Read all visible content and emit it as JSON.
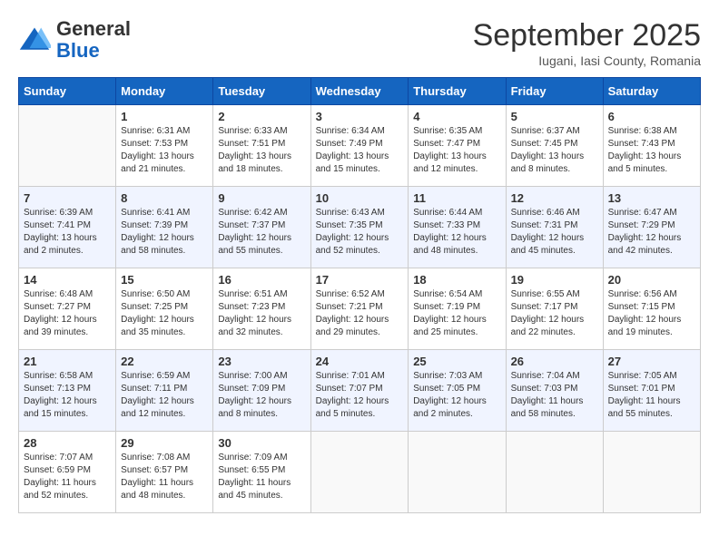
{
  "logo": {
    "general": "General",
    "blue": "Blue"
  },
  "title": {
    "month": "September 2025",
    "location": "Iugani, Iasi County, Romania"
  },
  "days_header": [
    "Sunday",
    "Monday",
    "Tuesday",
    "Wednesday",
    "Thursday",
    "Friday",
    "Saturday"
  ],
  "weeks": [
    [
      {
        "day": "",
        "info": ""
      },
      {
        "day": "1",
        "info": "Sunrise: 6:31 AM\nSunset: 7:53 PM\nDaylight: 13 hours\nand 21 minutes."
      },
      {
        "day": "2",
        "info": "Sunrise: 6:33 AM\nSunset: 7:51 PM\nDaylight: 13 hours\nand 18 minutes."
      },
      {
        "day": "3",
        "info": "Sunrise: 6:34 AM\nSunset: 7:49 PM\nDaylight: 13 hours\nand 15 minutes."
      },
      {
        "day": "4",
        "info": "Sunrise: 6:35 AM\nSunset: 7:47 PM\nDaylight: 13 hours\nand 12 minutes."
      },
      {
        "day": "5",
        "info": "Sunrise: 6:37 AM\nSunset: 7:45 PM\nDaylight: 13 hours\nand 8 minutes."
      },
      {
        "day": "6",
        "info": "Sunrise: 6:38 AM\nSunset: 7:43 PM\nDaylight: 13 hours\nand 5 minutes."
      }
    ],
    [
      {
        "day": "7",
        "info": "Sunrise: 6:39 AM\nSunset: 7:41 PM\nDaylight: 13 hours\nand 2 minutes."
      },
      {
        "day": "8",
        "info": "Sunrise: 6:41 AM\nSunset: 7:39 PM\nDaylight: 12 hours\nand 58 minutes."
      },
      {
        "day": "9",
        "info": "Sunrise: 6:42 AM\nSunset: 7:37 PM\nDaylight: 12 hours\nand 55 minutes."
      },
      {
        "day": "10",
        "info": "Sunrise: 6:43 AM\nSunset: 7:35 PM\nDaylight: 12 hours\nand 52 minutes."
      },
      {
        "day": "11",
        "info": "Sunrise: 6:44 AM\nSunset: 7:33 PM\nDaylight: 12 hours\nand 48 minutes."
      },
      {
        "day": "12",
        "info": "Sunrise: 6:46 AM\nSunset: 7:31 PM\nDaylight: 12 hours\nand 45 minutes."
      },
      {
        "day": "13",
        "info": "Sunrise: 6:47 AM\nSunset: 7:29 PM\nDaylight: 12 hours\nand 42 minutes."
      }
    ],
    [
      {
        "day": "14",
        "info": "Sunrise: 6:48 AM\nSunset: 7:27 PM\nDaylight: 12 hours\nand 39 minutes."
      },
      {
        "day": "15",
        "info": "Sunrise: 6:50 AM\nSunset: 7:25 PM\nDaylight: 12 hours\nand 35 minutes."
      },
      {
        "day": "16",
        "info": "Sunrise: 6:51 AM\nSunset: 7:23 PM\nDaylight: 12 hours\nand 32 minutes."
      },
      {
        "day": "17",
        "info": "Sunrise: 6:52 AM\nSunset: 7:21 PM\nDaylight: 12 hours\nand 29 minutes."
      },
      {
        "day": "18",
        "info": "Sunrise: 6:54 AM\nSunset: 7:19 PM\nDaylight: 12 hours\nand 25 minutes."
      },
      {
        "day": "19",
        "info": "Sunrise: 6:55 AM\nSunset: 7:17 PM\nDaylight: 12 hours\nand 22 minutes."
      },
      {
        "day": "20",
        "info": "Sunrise: 6:56 AM\nSunset: 7:15 PM\nDaylight: 12 hours\nand 19 minutes."
      }
    ],
    [
      {
        "day": "21",
        "info": "Sunrise: 6:58 AM\nSunset: 7:13 PM\nDaylight: 12 hours\nand 15 minutes."
      },
      {
        "day": "22",
        "info": "Sunrise: 6:59 AM\nSunset: 7:11 PM\nDaylight: 12 hours\nand 12 minutes."
      },
      {
        "day": "23",
        "info": "Sunrise: 7:00 AM\nSunset: 7:09 PM\nDaylight: 12 hours\nand 8 minutes."
      },
      {
        "day": "24",
        "info": "Sunrise: 7:01 AM\nSunset: 7:07 PM\nDaylight: 12 hours\nand 5 minutes."
      },
      {
        "day": "25",
        "info": "Sunrise: 7:03 AM\nSunset: 7:05 PM\nDaylight: 12 hours\nand 2 minutes."
      },
      {
        "day": "26",
        "info": "Sunrise: 7:04 AM\nSunset: 7:03 PM\nDaylight: 11 hours\nand 58 minutes."
      },
      {
        "day": "27",
        "info": "Sunrise: 7:05 AM\nSunset: 7:01 PM\nDaylight: 11 hours\nand 55 minutes."
      }
    ],
    [
      {
        "day": "28",
        "info": "Sunrise: 7:07 AM\nSunset: 6:59 PM\nDaylight: 11 hours\nand 52 minutes."
      },
      {
        "day": "29",
        "info": "Sunrise: 7:08 AM\nSunset: 6:57 PM\nDaylight: 11 hours\nand 48 minutes."
      },
      {
        "day": "30",
        "info": "Sunrise: 7:09 AM\nSunset: 6:55 PM\nDaylight: 11 hours\nand 45 minutes."
      },
      {
        "day": "",
        "info": ""
      },
      {
        "day": "",
        "info": ""
      },
      {
        "day": "",
        "info": ""
      },
      {
        "day": "",
        "info": ""
      }
    ]
  ]
}
